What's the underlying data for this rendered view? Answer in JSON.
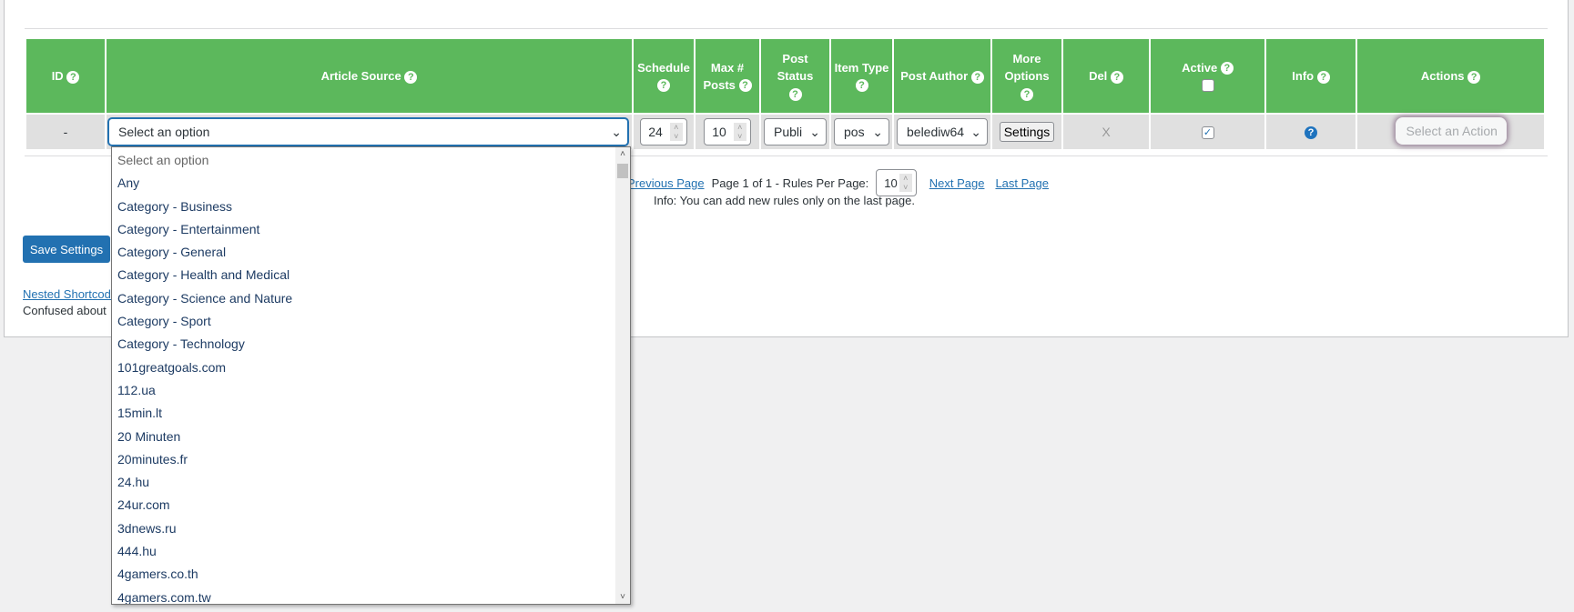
{
  "table": {
    "headers": [
      "ID",
      "Article Source",
      "Schedule",
      "Max # Posts",
      "Post Status",
      "Item Type",
      "Post Author",
      "More Options",
      "Del",
      "Active",
      "Info",
      "Actions"
    ],
    "row": {
      "id": "-",
      "article_source": "Select an option",
      "schedule": "24",
      "max_posts": "10",
      "post_status": "Publi",
      "item_type": "pos",
      "post_author": "belediw64",
      "more_options_button": "Settings",
      "del": "X",
      "active_checked": true,
      "actions": "Select an Action"
    }
  },
  "dropdown": {
    "options": [
      "Select an option",
      "Any",
      "Category - Business",
      "Category - Entertainment",
      "Category - General",
      "Category - Health and Medical",
      "Category - Science and Nature",
      "Category - Sport",
      "Category - Technology",
      "101greatgoals.com",
      "112.ua",
      "15min.lt",
      "20 Minuten",
      "20minutes.fr",
      "24.hu",
      "24ur.com",
      "3dnews.ru",
      "444.hu",
      "4gamers.co.th",
      "4gamers.com.tw"
    ]
  },
  "pagination": {
    "previous": "Previous Page",
    "status": "Page 1 of 1 - Rules Per Page:",
    "per_page": "10",
    "next": "Next Page",
    "last": "Last Page",
    "info": "Info: You can add new rules only on the last page."
  },
  "footer": {
    "save": "Save Settings",
    "nested": "Nested Shortcodes",
    "confused": "Confused about"
  },
  "colors": {
    "header_green": "#5cb85c",
    "primary_blue": "#2271b1"
  }
}
